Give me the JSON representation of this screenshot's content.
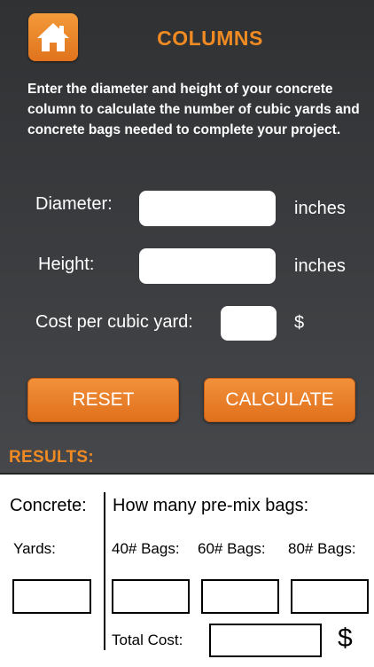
{
  "header": {
    "title": "COLUMNS",
    "home_icon": "home-icon"
  },
  "intro": "Enter the diameter and height of your concrete column to calculate the number of cubic yards and concrete bags needed to complete your project.",
  "form": {
    "diameter": {
      "label": "Diameter:",
      "value": "",
      "unit": "inches"
    },
    "height": {
      "label": "Height:",
      "value": "",
      "unit": "inches"
    },
    "cost": {
      "label": "Cost per cubic yard:",
      "value": "",
      "unit": "$"
    }
  },
  "buttons": {
    "reset": "RESET",
    "calculate": "CALCULATE"
  },
  "results": {
    "title": "RESULTS:",
    "concrete_heading": "Concrete:",
    "bags_heading": "How many pre-mix bags:",
    "yards_label": "Yards:",
    "bag40_label": "40# Bags:",
    "bag60_label": "60# Bags:",
    "bag80_label": "80# Bags:",
    "total_cost_label": "Total Cost:",
    "currency": "$",
    "yards_value": "",
    "bag40_value": "",
    "bag60_value": "",
    "bag80_value": "",
    "total_cost_value": ""
  },
  "colors": {
    "accent": "#f08a22",
    "button": "#e87d25",
    "background": "#3b3d40"
  }
}
